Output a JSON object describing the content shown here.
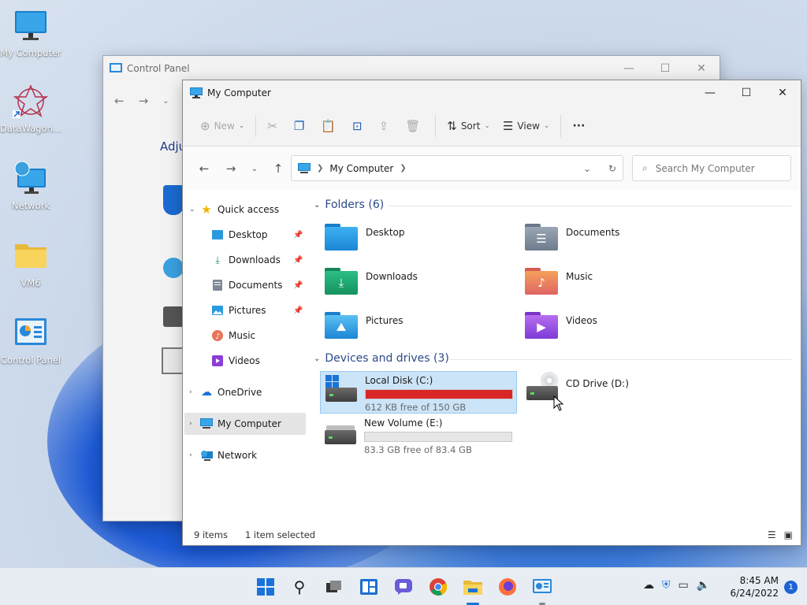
{
  "desktop": {
    "icons": [
      {
        "label": "My Computer"
      },
      {
        "label": "DataWagon…"
      },
      {
        "label": "Network"
      },
      {
        "label": "VM6"
      },
      {
        "label": "Control Panel"
      }
    ]
  },
  "control_panel": {
    "title": "Control Panel",
    "partial_heading": "Adju"
  },
  "window": {
    "title": "My Computer",
    "toolbar": {
      "new_label": "New",
      "sort_label": "Sort",
      "view_label": "View",
      "more_label": "···"
    },
    "address": {
      "path": "My Computer"
    },
    "search": {
      "placeholder": "Search My Computer"
    },
    "sidebar": {
      "quick_access": "Quick access",
      "pinned": [
        {
          "label": "Desktop"
        },
        {
          "label": "Downloads"
        },
        {
          "label": "Documents"
        },
        {
          "label": "Pictures"
        },
        {
          "label": "Music"
        },
        {
          "label": "Videos"
        }
      ],
      "onedrive": "OneDrive",
      "my_computer": "My Computer",
      "network": "Network"
    },
    "folders_header": "Folders (6)",
    "folders": [
      {
        "name": "Desktop"
      },
      {
        "name": "Documents"
      },
      {
        "name": "Downloads"
      },
      {
        "name": "Music"
      },
      {
        "name": "Pictures"
      },
      {
        "name": "Videos"
      }
    ],
    "drives_header": "Devices and drives (3)",
    "drives": [
      {
        "name": "Local Disk (C:)",
        "free": "612 KB free of 150 GB",
        "used_fraction": 1.0,
        "bar_color": "#da2626"
      },
      {
        "name": "CD Drive (D:)"
      },
      {
        "name": "New Volume (E:)",
        "free": "83.3 GB free of 83.4 GB",
        "used_fraction": 0.0,
        "bar_color": "#26a0da"
      }
    ],
    "status": {
      "items": "9 items",
      "selected": "1 item selected"
    }
  },
  "taskbar": {
    "time": "8:45 AM",
    "date": "6/24/2022",
    "notification_count": "1"
  },
  "colors": {
    "accent": "#0067c0",
    "selection": "#cce4f7"
  }
}
